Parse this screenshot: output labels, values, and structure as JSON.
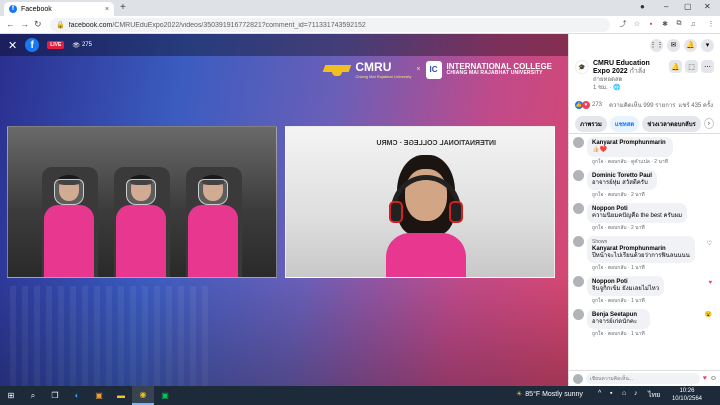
{
  "browser": {
    "tab_title": "Facebook",
    "tab_favicon": "f",
    "url_host": "facebook.com",
    "url_rest": "/CMRUEduExpo2022/videos/350391916772821?comment_id=711331743592152",
    "new_tab": "+",
    "tab_close": "×"
  },
  "video": {
    "live_label": "LIVE",
    "viewer_count": "275",
    "brand_cmru": "CMRU",
    "brand_cmru_sub": "Chiang Mai Rajabhat University",
    "brand_sep": "×",
    "brand_ic_title": "INTERNATIONAL COLLEGE",
    "brand_ic_sub": "CHIANG MAI RAJABHAT UNIVERSITY",
    "crest": "IC",
    "frame1_overlay": "",
    "frame2_sign": "INTERNATIONAL COLLEGE · CMRU"
  },
  "sidebar": {
    "page_name": "CMRU Education Expo 2022",
    "page_status": "กำลัง",
    "page_sub1": "ถ่ายทอดสด",
    "page_sub2": "1 ชม. · 🌐",
    "reaction_count": "273",
    "comment_count": "ความคิดเห็น 999 รายการ",
    "share_count": "แชร์ 435 ครั้ง",
    "filters": [
      "ภาพรวม",
      "แชทสด",
      "ช่วงเวลาตอบกลับร"
    ],
    "reply_meta": "ถูกใจ · ตอบกลับ",
    "comments": [
      {
        "name": "Kanyarat Promphunmarin",
        "text": "👍🏻❤️",
        "meta": "ถูกใจ · ตอบกลับ · ดูคำแปล · 2 นาที",
        "badge": ""
      },
      {
        "name": "Dominic Toretto Paul",
        "text": "อาจารย์หุ่ม สวัสดีครับ",
        "meta": "ถูกใจ · ตอบกลับ · 2 นาที",
        "badge": ""
      },
      {
        "name": "Noppon Poti",
        "text": "ความนิยมคปัญคือ the best ครับผม",
        "meta": "ถูกใจ · ตอบกลับ · 2 นาที",
        "badge": ""
      },
      {
        "name": "Kanyarat Promphunmarin",
        "text": "ปีหน้าจะไปเรียนด้วยว่าการฟินลนนนน",
        "meta": "ถูกใจ · ตอบกลับ · 1 นาที",
        "badge": "Shown"
      },
      {
        "name": "Noppon Poti",
        "text": "จินจูกิกเข้ม ยังมเลยไม่ไหว",
        "meta": "ถูกใจ · ตอบกลับ · 1 นาที",
        "badge": ""
      },
      {
        "name": "Benja Seetapun",
        "text": "อาจารย์เก่ดนักคะ",
        "meta": "ถูกใจ · ตอบกลับ · 1 นาที",
        "badge": ""
      }
    ],
    "composer_placeholder": "เขียนความคิดเห็น..."
  },
  "taskbar": {
    "weather": "85°F Mostly sunny",
    "time": "10:26",
    "date": "10/10/2564",
    "lang": "ไทย"
  },
  "colors": {
    "fb_blue": "#1877f2",
    "live_red": "#e41e3f",
    "shirt_pink": "#e8378f"
  }
}
